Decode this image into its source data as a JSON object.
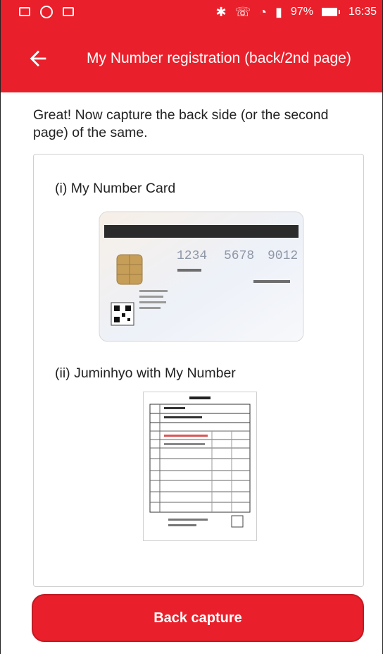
{
  "status_bar": {
    "left_icons": [
      "image-icon",
      "shield-icon",
      "image-icon"
    ],
    "bluetooth_icon": "bluetooth-icon",
    "call_icon": "phone-call-icon",
    "wifi_icon": "wifi-icon",
    "signal_icon": "signal-icon",
    "battery_percent": "97%",
    "time": "16:35"
  },
  "toolbar": {
    "back_icon": "back-arrow-icon",
    "title": "My Number registration (back/2nd page)"
  },
  "intro": {
    "text": "Great! Now capture the back side (or the second page) of the same."
  },
  "sections": [
    {
      "heading": "(i) My Number Card",
      "image": "my-number-card-back-image"
    },
    {
      "heading": "(ii) Juminhyo with My Number",
      "image": "juminhyo-document-image"
    }
  ],
  "card_sample": {
    "digits": [
      "1234",
      "5678",
      "9012"
    ]
  },
  "actions": {
    "primary_label": "Back capture"
  },
  "colors": {
    "brand_red": "#e9202b",
    "text": "#222222",
    "border": "#cfcfcf"
  }
}
